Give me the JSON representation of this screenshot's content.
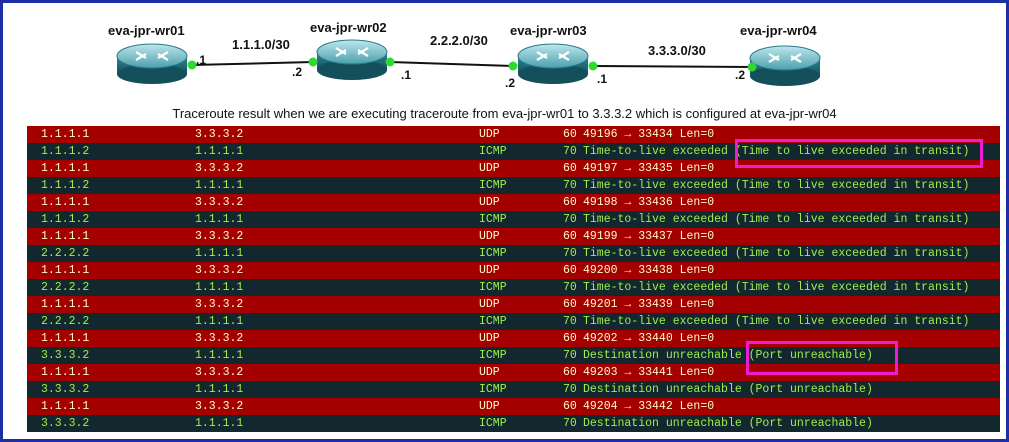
{
  "topology": {
    "routers": [
      {
        "name": "eva-jpr-wr01"
      },
      {
        "name": "eva-jpr-wr02"
      },
      {
        "name": "eva-jpr-wr03"
      },
      {
        "name": "eva-jpr-wr04"
      }
    ],
    "links": [
      {
        "network": "1.1.1.0/30",
        "left_if": ".1",
        "right_if": ".2"
      },
      {
        "network": "2.2.2.0/30",
        "left_if": ".1",
        "right_if": ".2"
      },
      {
        "network": "3.3.3.0/30",
        "left_if": ".1",
        "right_if": ".2"
      }
    ],
    "caption": "Traceroute result when we are executing traceroute from eva-jpr-wr01 to 3.3.3.2 which is configured at eva-jpr-wr04"
  },
  "colors": {
    "frame": "#1d2fa5",
    "udp_row_bg": "#a40000",
    "udp_row_text": "#fffbc7",
    "icmp_row_bg": "#12272e",
    "icmp_row_text": "#9ef04e",
    "highlight": "#ee1bd2",
    "interface_dot": "#2fd92f"
  },
  "packets": [
    {
      "src": "1.1.1.1",
      "dst": "3.3.3.2",
      "proto": "UDP",
      "len": "60",
      "info": "49196 → 33434 Len=0"
    },
    {
      "src": "1.1.1.2",
      "dst": "1.1.1.1",
      "proto": "ICMP",
      "len": "70",
      "info": "Time-to-live exceeded (Time to live exceeded in transit)"
    },
    {
      "src": "1.1.1.1",
      "dst": "3.3.3.2",
      "proto": "UDP",
      "len": "60",
      "info": "49197 → 33435 Len=0"
    },
    {
      "src": "1.1.1.2",
      "dst": "1.1.1.1",
      "proto": "ICMP",
      "len": "70",
      "info": "Time-to-live exceeded (Time to live exceeded in transit)"
    },
    {
      "src": "1.1.1.1",
      "dst": "3.3.3.2",
      "proto": "UDP",
      "len": "60",
      "info": "49198 → 33436 Len=0"
    },
    {
      "src": "1.1.1.2",
      "dst": "1.1.1.1",
      "proto": "ICMP",
      "len": "70",
      "info": "Time-to-live exceeded (Time to live exceeded in transit)"
    },
    {
      "src": "1.1.1.1",
      "dst": "3.3.3.2",
      "proto": "UDP",
      "len": "60",
      "info": "49199 → 33437 Len=0"
    },
    {
      "src": "2.2.2.2",
      "dst": "1.1.1.1",
      "proto": "ICMP",
      "len": "70",
      "info": "Time-to-live exceeded (Time to live exceeded in transit)"
    },
    {
      "src": "1.1.1.1",
      "dst": "3.3.3.2",
      "proto": "UDP",
      "len": "60",
      "info": "49200 → 33438 Len=0"
    },
    {
      "src": "2.2.2.2",
      "dst": "1.1.1.1",
      "proto": "ICMP",
      "len": "70",
      "info": "Time-to-live exceeded (Time to live exceeded in transit)"
    },
    {
      "src": "1.1.1.1",
      "dst": "3.3.3.2",
      "proto": "UDP",
      "len": "60",
      "info": "49201 → 33439 Len=0"
    },
    {
      "src": "2.2.2.2",
      "dst": "1.1.1.1",
      "proto": "ICMP",
      "len": "70",
      "info": "Time-to-live exceeded (Time to live exceeded in transit)"
    },
    {
      "src": "1.1.1.1",
      "dst": "3.3.3.2",
      "proto": "UDP",
      "len": "60",
      "info": "49202 → 33440 Len=0"
    },
    {
      "src": "3.3.3.2",
      "dst": "1.1.1.1",
      "proto": "ICMP",
      "len": "70",
      "info": "Destination unreachable (Port unreachable)"
    },
    {
      "src": "1.1.1.1",
      "dst": "3.3.3.2",
      "proto": "UDP",
      "len": "60",
      "info": "49203 → 33441 Len=0"
    },
    {
      "src": "3.3.3.2",
      "dst": "1.1.1.1",
      "proto": "ICMP",
      "len": "70",
      "info": "Destination unreachable (Port unreachable)"
    },
    {
      "src": "1.1.1.1",
      "dst": "3.3.3.2",
      "proto": "UDP",
      "len": "60",
      "info": "49204 → 33442 Len=0"
    },
    {
      "src": "3.3.3.2",
      "dst": "1.1.1.1",
      "proto": "ICMP",
      "len": "70",
      "info": "Destination unreachable (Port unreachable)"
    }
  ]
}
